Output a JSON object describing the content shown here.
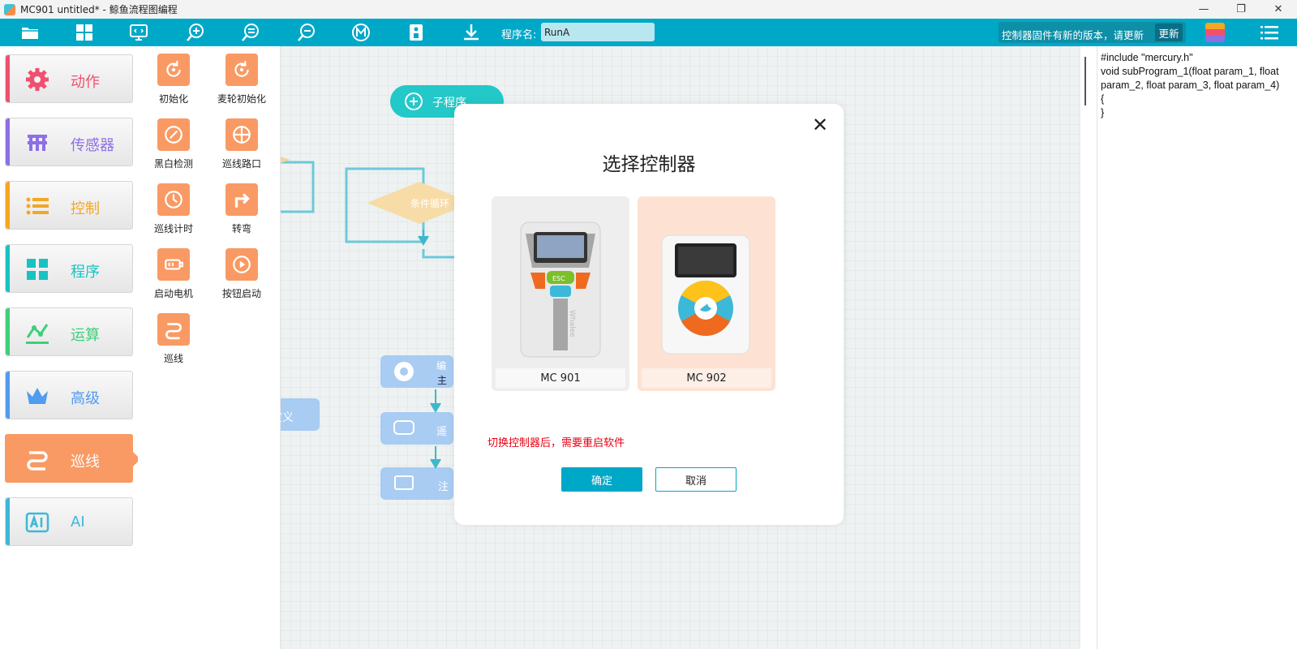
{
  "window": {
    "title": "MC901 untitled* - 鲸鱼流程图编程",
    "minimize": "—",
    "restore": "❐",
    "close": "✕"
  },
  "toolbar": {
    "program_name_label": "程序名:",
    "program_name_value": "RunA",
    "firmware_notice": "控制器固件有新的版本，请更新",
    "update_button": "更新",
    "accent_color": "#00a8c8"
  },
  "categories": [
    {
      "label": "动作",
      "color": "#f0506e",
      "icon": "gear-icon"
    },
    {
      "label": "传感器",
      "color": "#8d6fe6",
      "icon": "sensor-icon"
    },
    {
      "label": "控制",
      "color": "#f5a623",
      "icon": "list-icon"
    },
    {
      "label": "程序",
      "color": "#19c2c2",
      "icon": "grid-icon"
    },
    {
      "label": "运算",
      "color": "#3fcf79",
      "icon": "graph-icon"
    },
    {
      "label": "高级",
      "color": "#4f9cf0",
      "icon": "crown-icon"
    },
    {
      "label": "巡线",
      "color": "#ffffff",
      "icon": "path-icon"
    },
    {
      "label": "AI",
      "color": "#3cb8d8",
      "icon": "ai-icon"
    }
  ],
  "blocks": [
    {
      "label": "初始化",
      "icon": "reset-icon"
    },
    {
      "label": "麦轮初始化",
      "icon": "reset-icon"
    },
    {
      "label": "黑白检测",
      "icon": "gauge-icon"
    },
    {
      "label": "巡线路口",
      "icon": "crosshair-icon"
    },
    {
      "label": "巡线计时",
      "icon": "clock-icon"
    },
    {
      "label": "转弯",
      "icon": "turn-arrow-icon"
    },
    {
      "label": "启动电机",
      "icon": "motor-icon"
    },
    {
      "label": "按钮启动",
      "icon": "play-icon"
    },
    {
      "label": "巡线",
      "icon": "path-icon"
    }
  ],
  "canvas": {
    "subprogram_label": "子程序",
    "condition_label": "条件循环",
    "define_fragment": "定义",
    "node_fragment": "编",
    "node_fragment2": "主",
    "node_fragment3": "遥",
    "node_fragment4": "注"
  },
  "code": [
    "#include \"mercury.h\"",
    "void subProgram_1(float param_1, float",
    "param_2, float param_3, float param_4)",
    "{",
    "}"
  ],
  "dialog": {
    "close_glyph": "✕",
    "title": "选择控制器",
    "controllers": [
      {
        "name": "MC 901"
      },
      {
        "name": "MC 902"
      }
    ],
    "device_esc": "ESC",
    "device_brand": "Whalee",
    "warning": "切换控制器后，需要重启软件",
    "ok": "确定",
    "cancel": "取消"
  }
}
